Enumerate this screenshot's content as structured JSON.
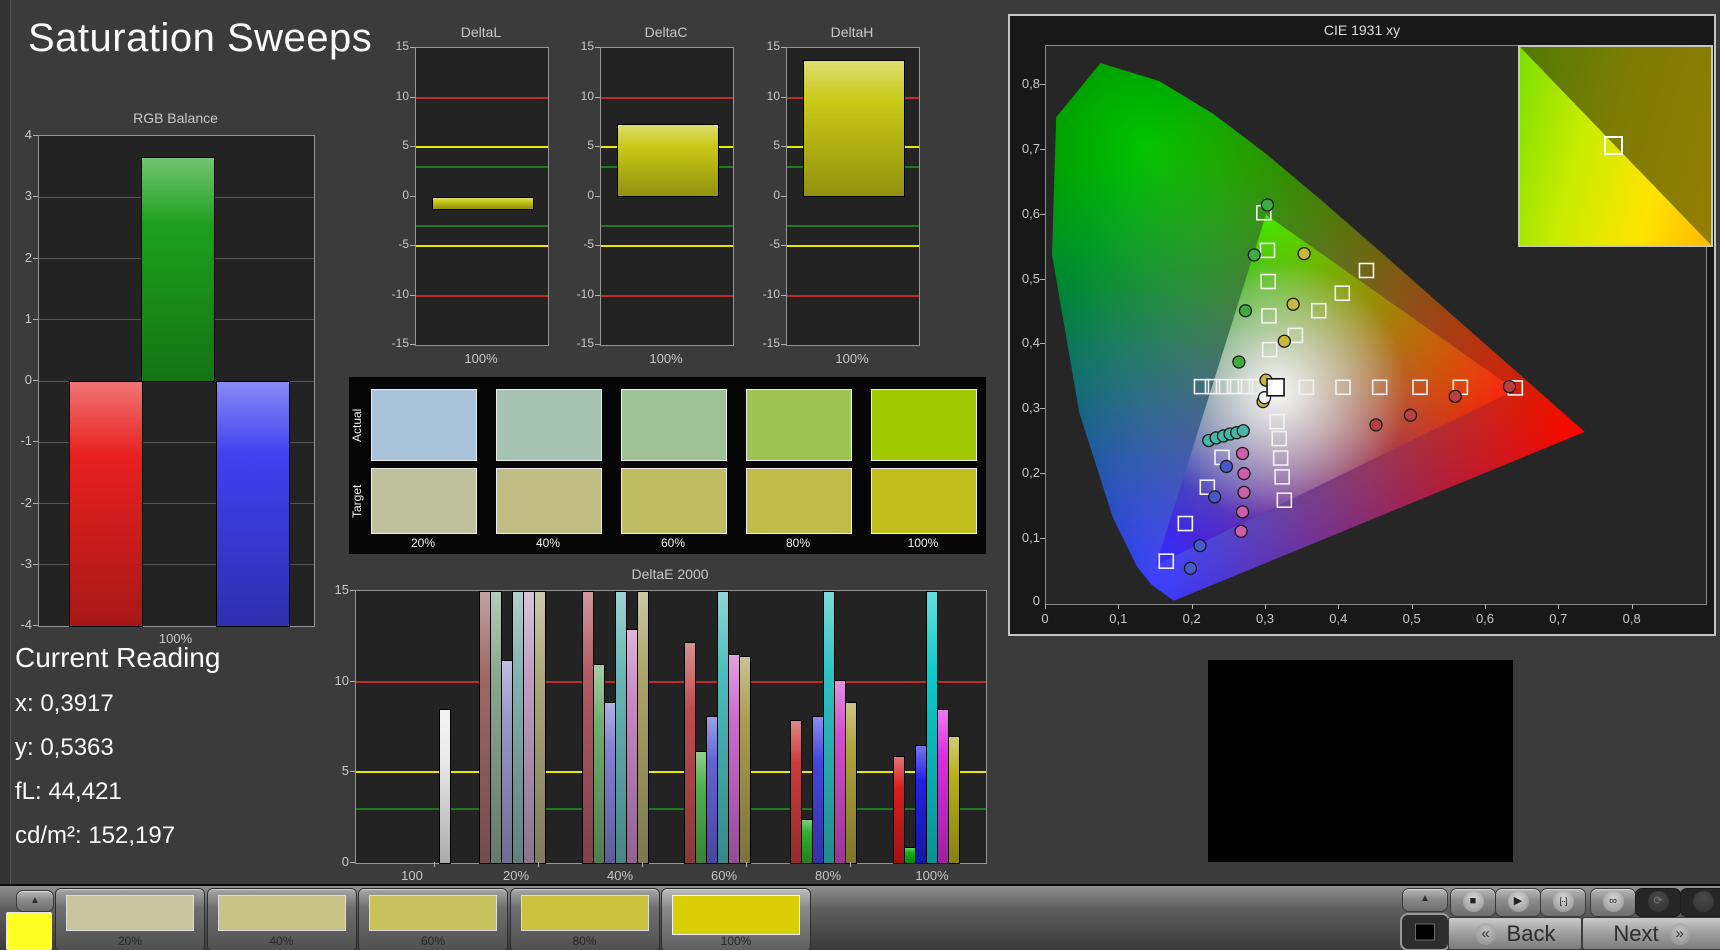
{
  "title": "Saturation Sweeps",
  "current_reading": {
    "heading": "Current Reading",
    "lines": [
      "x: 0,3917",
      "y: 0,5363",
      "fL: 44,421",
      "cd/m²: 152,197"
    ]
  },
  "colors": {
    "ref_red": "#c22a2a",
    "ref_yellow": "#e8e800",
    "ref_green": "#1e7a1e",
    "grid": "#555555",
    "plot_bg": "#232323",
    "panel_black": "#060606"
  },
  "chart_data": [
    {
      "type": "bar",
      "title": "RGB Balance",
      "xlabel": "100%",
      "ylim": [
        -4,
        4
      ],
      "yticks": [
        4,
        3,
        2,
        1,
        0,
        -1,
        -2,
        -3,
        -4
      ],
      "categories": [
        "red",
        "green",
        "blue"
      ],
      "values": [
        -4,
        3.65,
        -4
      ],
      "bar_colors": [
        "#e82020",
        "#1ca01c",
        "#4040f0"
      ]
    },
    {
      "type": "bar",
      "title": "DeltaL",
      "xlabel": "100%",
      "ylim": [
        -15,
        15
      ],
      "yticks": [
        15,
        10,
        5,
        0,
        -5,
        -10,
        -15
      ],
      "values": [
        -1.3
      ],
      "ref_lines": {
        "red": [
          10,
          -10
        ],
        "yellow": [
          5,
          -5
        ],
        "green": [
          3,
          -3
        ]
      }
    },
    {
      "type": "bar",
      "title": "DeltaC",
      "xlabel": "100%",
      "ylim": [
        -15,
        15
      ],
      "yticks": [
        15,
        10,
        5,
        0,
        -5,
        -10,
        -15
      ],
      "values": [
        7.3
      ],
      "ref_lines": {
        "red": [
          10,
          -10
        ],
        "yellow": [
          5,
          -5
        ],
        "green": [
          3,
          -3
        ]
      }
    },
    {
      "type": "bar",
      "title": "DeltaH",
      "xlabel": "100%",
      "ylim": [
        -15,
        15
      ],
      "yticks": [
        15,
        10,
        5,
        0,
        -5,
        -10,
        -15
      ],
      "values": [
        13.8
      ],
      "ref_lines": {
        "red": [
          10,
          -10
        ],
        "yellow": [
          5,
          -5
        ],
        "green": [
          3,
          -3
        ]
      }
    },
    {
      "type": "bar",
      "title": "DeltaE 2000",
      "ylim": [
        0,
        15
      ],
      "yticks": [
        15,
        10,
        5,
        0
      ],
      "ref_lines": {
        "red": 10,
        "yellow": 5,
        "green": 3
      },
      "groups": [
        {
          "label": "100",
          "bars": [
            {
              "color": "#ececec",
              "value": 8.5
            }
          ]
        },
        {
          "label": "20%",
          "bars": [
            {
              "color": "#a06868",
              "value": 15
            },
            {
              "color": "#8da88d",
              "value": 15
            },
            {
              "color": "#9797c8",
              "value": 11.2
            },
            {
              "color": "#84b2b2",
              "value": 15
            },
            {
              "color": "#c29fc2",
              "value": 15
            },
            {
              "color": "#aea87e",
              "value": 15
            }
          ]
        },
        {
          "label": "40%",
          "bars": [
            {
              "color": "#b25a64",
              "value": 15
            },
            {
              "color": "#6dae6d",
              "value": 11.0
            },
            {
              "color": "#8181d0",
              "value": 8.9
            },
            {
              "color": "#68b7b7",
              "value": 15
            },
            {
              "color": "#c789c7",
              "value": 12.9
            },
            {
              "color": "#aca668",
              "value": 15
            }
          ]
        },
        {
          "label": "60%",
          "bars": [
            {
              "color": "#c04d4d",
              "value": 12.2
            },
            {
              "color": "#50b150",
              "value": 6.2
            },
            {
              "color": "#6363da",
              "value": 8.1
            },
            {
              "color": "#4cbcbc",
              "value": 15
            },
            {
              "color": "#cc6ccc",
              "value": 11.5
            },
            {
              "color": "#a89e50",
              "value": 11.4
            }
          ]
        },
        {
          "label": "80%",
          "bars": [
            {
              "color": "#cc3b3b",
              "value": 7.9
            },
            {
              "color": "#2cb02c",
              "value": 2.4
            },
            {
              "color": "#4545e0",
              "value": 8.1
            },
            {
              "color": "#2ec2c2",
              "value": 15
            },
            {
              "color": "#d14cd1",
              "value": 10.1
            },
            {
              "color": "#aea337",
              "value": 8.9
            }
          ]
        },
        {
          "label": "100%",
          "bars": [
            {
              "color": "#d91d1d",
              "value": 5.9
            },
            {
              "color": "#0fb60f",
              "value": 0.9
            },
            {
              "color": "#2020e8",
              "value": 6.5
            },
            {
              "color": "#0ccaca",
              "value": 15
            },
            {
              "color": "#dd2cdd",
              "value": 8.5
            },
            {
              "color": "#bab017",
              "value": 7.0
            }
          ]
        }
      ]
    }
  ],
  "swatches": {
    "row_labels": [
      "Actual",
      "Target"
    ],
    "labels": [
      "20%",
      "40%",
      "60%",
      "80%",
      "100%"
    ],
    "actual": [
      "#a8c3da",
      "#a5c2b3",
      "#9fc295",
      "#9ec353",
      "#a2c800"
    ],
    "target": [
      "#bfc09c",
      "#bfbd84",
      "#c0bc62",
      "#bfbd48",
      "#c1bf1d"
    ]
  },
  "cie": {
    "title": "CIE 1931 xy",
    "x_ticks": [
      "0",
      "0,1",
      "0,2",
      "0,3",
      "0,4",
      "0,5",
      "0,6",
      "0,7",
      "0,8"
    ],
    "y_ticks": [
      "0,1",
      "0,2",
      "0,3",
      "0,4",
      "0,5",
      "0,6",
      "0,7",
      "0,8"
    ],
    "y_zero": "0",
    "x_max": 0.9,
    "y_max": 0.86,
    "locus": [
      [
        0.1741,
        0.005
      ],
      [
        0.144,
        0.0297
      ],
      [
        0.1241,
        0.0578
      ],
      [
        0.0913,
        0.1327
      ],
      [
        0.0454,
        0.295
      ],
      [
        0.0082,
        0.5384
      ],
      [
        0.0139,
        0.7502
      ],
      [
        0.0743,
        0.8338
      ],
      [
        0.1547,
        0.8059
      ],
      [
        0.2296,
        0.7543
      ],
      [
        0.3016,
        0.6923
      ],
      [
        0.3731,
        0.6245
      ],
      [
        0.4441,
        0.5547
      ],
      [
        0.5125,
        0.4866
      ],
      [
        0.5752,
        0.4242
      ],
      [
        0.627,
        0.3725
      ],
      [
        0.6658,
        0.334
      ],
      [
        0.6915,
        0.3083
      ],
      [
        0.7347,
        0.2653
      ]
    ],
    "gamut_triangle": [
      [
        0.64,
        0.33
      ],
      [
        0.3,
        0.6
      ],
      [
        0.15,
        0.06
      ]
    ],
    "white_point_square": [
      0.313,
      0.334
    ],
    "target_squares": [
      [
        0.297,
        0.603
      ],
      [
        0.302,
        0.545
      ],
      [
        0.303,
        0.497
      ],
      [
        0.304,
        0.444
      ],
      [
        0.305,
        0.392
      ],
      [
        0.34,
        0.414
      ],
      [
        0.372,
        0.452
      ],
      [
        0.404,
        0.479
      ],
      [
        0.437,
        0.514
      ],
      [
        0.355,
        0.334
      ],
      [
        0.405,
        0.334
      ],
      [
        0.455,
        0.334
      ],
      [
        0.51,
        0.334
      ],
      [
        0.565,
        0.334
      ],
      [
        0.64,
        0.333
      ],
      [
        0.212,
        0.335
      ],
      [
        0.227,
        0.335
      ],
      [
        0.242,
        0.335
      ],
      [
        0.257,
        0.335
      ],
      [
        0.272,
        0.335
      ],
      [
        0.287,
        0.335
      ],
      [
        0.315,
        0.281
      ],
      [
        0.318,
        0.255
      ],
      [
        0.32,
        0.225
      ],
      [
        0.322,
        0.196
      ],
      [
        0.325,
        0.16
      ],
      [
        0.24,
        0.226
      ],
      [
        0.22,
        0.18
      ],
      [
        0.19,
        0.124
      ],
      [
        0.164,
        0.066
      ]
    ],
    "measured_points": [
      {
        "color": "#3faa3f",
        "pts": [
          [
            0.302,
            0.615
          ],
          [
            0.284,
            0.538
          ],
          [
            0.272,
            0.452
          ],
          [
            0.263,
            0.373
          ]
        ]
      },
      {
        "color": "#c8b83a",
        "pts": [
          [
            0.352,
            0.54
          ],
          [
            0.337,
            0.462
          ],
          [
            0.325,
            0.405
          ],
          [
            0.3,
            0.345
          ],
          [
            0.296,
            0.312
          ]
        ]
      },
      {
        "color": "#b84040",
        "pts": [
          [
            0.632,
            0.335
          ],
          [
            0.558,
            0.32
          ],
          [
            0.497,
            0.291
          ],
          [
            0.45,
            0.276
          ]
        ]
      },
      {
        "color": "#45b8a8",
        "pts": [
          [
            0.222,
            0.252
          ],
          [
            0.232,
            0.256
          ],
          [
            0.242,
            0.259
          ],
          [
            0.251,
            0.262
          ],
          [
            0.26,
            0.264
          ],
          [
            0.269,
            0.267
          ]
        ]
      },
      {
        "color": "#cc5fa8",
        "pts": [
          [
            0.268,
            0.232
          ],
          [
            0.27,
            0.201
          ],
          [
            0.27,
            0.172
          ],
          [
            0.268,
            0.142
          ],
          [
            0.266,
            0.112
          ]
        ]
      },
      {
        "color": "#4858c8",
        "pts": [
          [
            0.246,
            0.212
          ],
          [
            0.23,
            0.165
          ],
          [
            0.21,
            0.09
          ],
          [
            0.197,
            0.055
          ]
        ]
      },
      {
        "color": "#f2f2f2",
        "pts": [
          [
            0.298,
            0.318
          ]
        ]
      }
    ]
  },
  "toolbar": {
    "patches": [
      {
        "label": "20%",
        "color": "#c6c5a0"
      },
      {
        "label": "40%",
        "color": "#c8c487"
      },
      {
        "label": "60%",
        "color": "#c7c15e"
      },
      {
        "label": "80%",
        "color": "#cbc340"
      },
      {
        "label": "100%",
        "color": "#d9ce08",
        "selected": true
      }
    ],
    "quick_swatch_color": "#ffff22",
    "small_buttons": [
      "stop",
      "play",
      "bracket",
      "infinity",
      "refresh",
      "blank"
    ],
    "glyphs": {
      "stop": "■",
      "play": "▶",
      "bracket": "[··]",
      "infinity": "∞",
      "refresh": "⟳",
      "blank": ""
    },
    "back_label": "Back",
    "next_label": "Next",
    "back_glyph": "«",
    "next_glyph": "»"
  }
}
